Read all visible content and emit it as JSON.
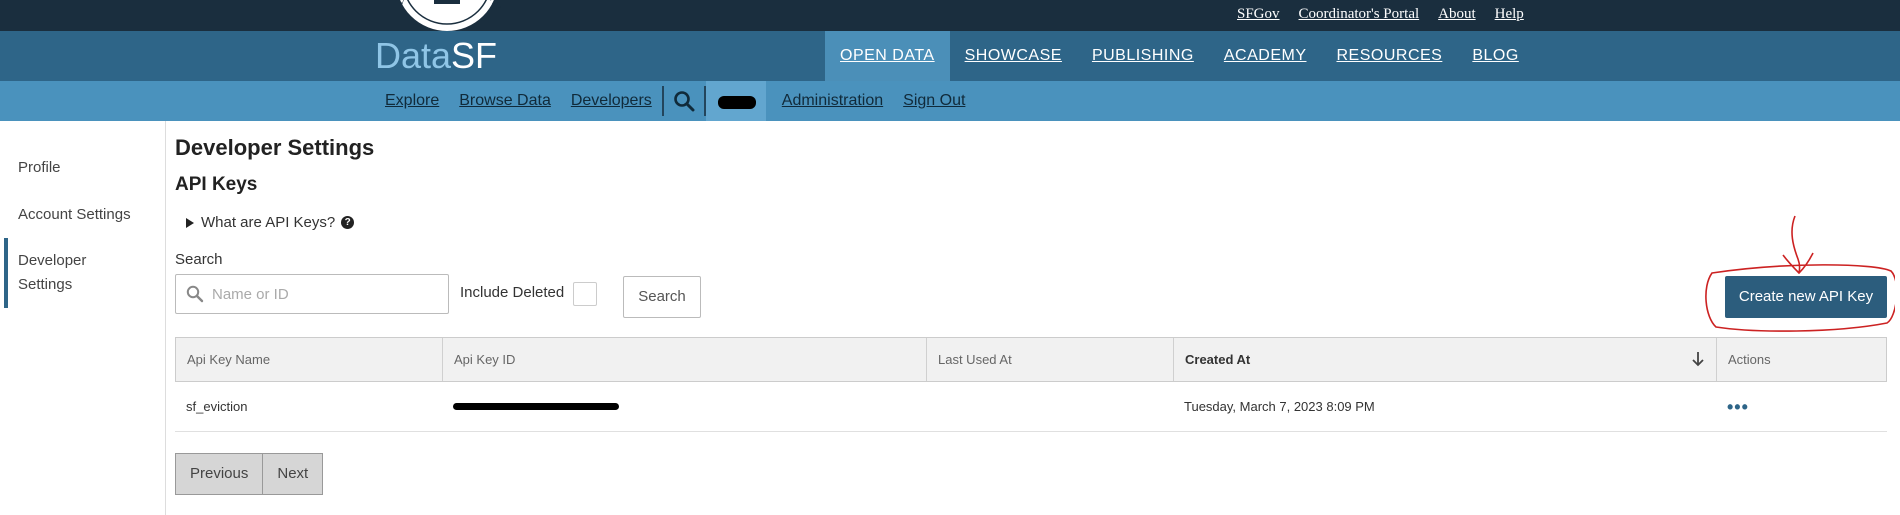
{
  "topbar": {
    "links": [
      "SFGov",
      "Coordinator's Portal",
      "About",
      "Help"
    ]
  },
  "logo": {
    "part1": "Data",
    "part2": "SF"
  },
  "mainnav": {
    "items": [
      "OPEN DATA",
      "SHOWCASE",
      "PUBLISHING",
      "ACADEMY",
      "RESOURCES",
      "BLOG"
    ],
    "active": "OPEN DATA"
  },
  "subnav": {
    "links": [
      "Explore",
      "Browse Data",
      "Developers"
    ],
    "admin": "Administration",
    "signout": "Sign Out"
  },
  "sidebar": {
    "items": [
      "Profile",
      "Account Settings",
      "Developer Settings"
    ],
    "active": "Developer Settings"
  },
  "page": {
    "title": "Developer Settings",
    "subtitle": "API Keys",
    "disclosure": "What are API Keys?",
    "help_glyph": "?"
  },
  "search": {
    "label": "Search",
    "placeholder": "Name or ID",
    "value": "",
    "include_deleted_label": "Include Deleted",
    "include_deleted": false,
    "button": "Search"
  },
  "create_button": "Create new API Key",
  "table": {
    "columns": [
      "Api Key Name",
      "Api Key ID",
      "Last Used At",
      "Created At",
      "Actions"
    ],
    "sorted_by": "Created At",
    "rows": [
      {
        "name": "sf_eviction",
        "id": "",
        "last_used": "",
        "created": "Tuesday, March 7, 2023 8:09 PM",
        "actions_glyph": "•••"
      }
    ]
  },
  "pagination": {
    "previous": "Previous",
    "next": "Next"
  },
  "colors": {
    "topbar": "#1a2e3e",
    "mainnav": "#2e6588",
    "subnav": "#4a92bd",
    "primary_button": "#2c5d7d",
    "annotation": "#cc2222"
  }
}
